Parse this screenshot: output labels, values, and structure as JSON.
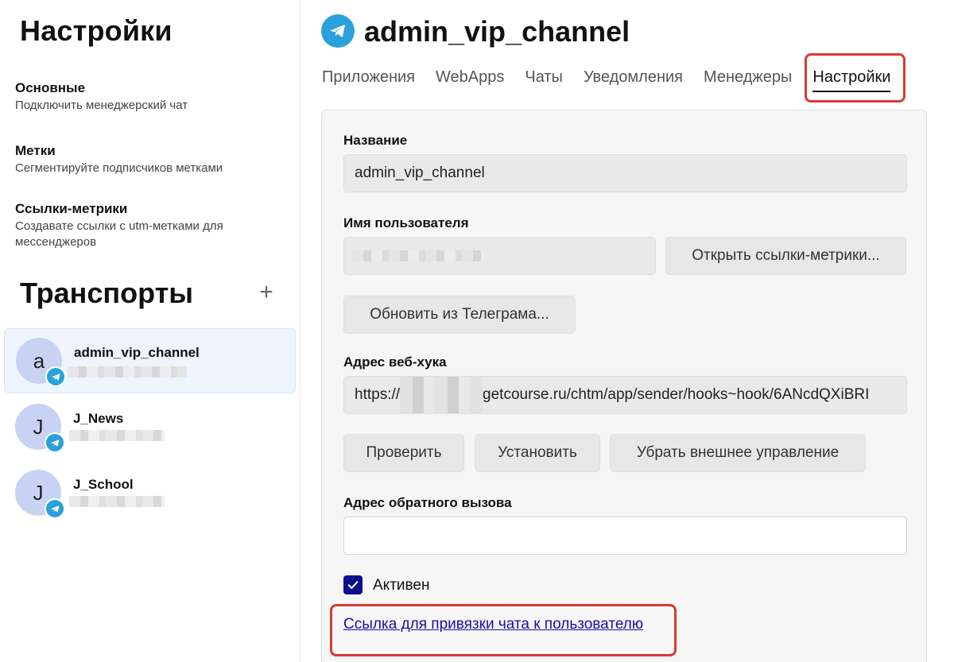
{
  "sidebar": {
    "title": "Настройки",
    "items": [
      {
        "title": "Основные",
        "desc": "Подключить менеджерский чат"
      },
      {
        "title": "Метки",
        "desc": "Сегментируйте подписчиков метками"
      },
      {
        "title": "Ссылки-метрики",
        "desc": "Создавате ссылки с utm-метками для мессенджеров"
      }
    ],
    "transports_title": "Транспорты",
    "add_symbol": "+",
    "channels": [
      {
        "initial": "a",
        "name": "admin_vip_channel"
      },
      {
        "initial": "J",
        "name": "J_News"
      },
      {
        "initial": "J",
        "name": "J_School"
      }
    ]
  },
  "header": {
    "title": "admin_vip_channel",
    "logo_icon": "telegram-icon"
  },
  "tabs": [
    {
      "label": "Приложения"
    },
    {
      "label": "WebApps"
    },
    {
      "label": "Чаты"
    },
    {
      "label": "Уведомления"
    },
    {
      "label": "Менеджеры"
    },
    {
      "label": "Настройки",
      "active": true
    }
  ],
  "form": {
    "name_label": "Название",
    "name_value": "admin_vip_channel",
    "username_label": "Имя пользователя",
    "open_links_button": "Открыть ссылки-метрики...",
    "refresh_button": "Обновить из Телеграма...",
    "webhook_label": "Адрес веб-хука",
    "webhook_prefix": "https://",
    "webhook_suffix": "getcourse.ru/chtm/app/sender/hooks~hook/6ANcdQXiBRI",
    "check_button": "Проверить",
    "install_button": "Установить",
    "remove_control_button": "Убрать внешнее управление",
    "callback_label": "Адрес обратного вызова",
    "callback_value": "",
    "active_label": "Активен",
    "active_checked": true,
    "bind_link": "Ссылка для привязки чата к пользователю"
  },
  "colors": {
    "accent_red": "#d93a33",
    "telegram_blue": "#2aa1da",
    "checkbox_navy": "#0b0f8c",
    "link_blue": "#1a0dab"
  }
}
